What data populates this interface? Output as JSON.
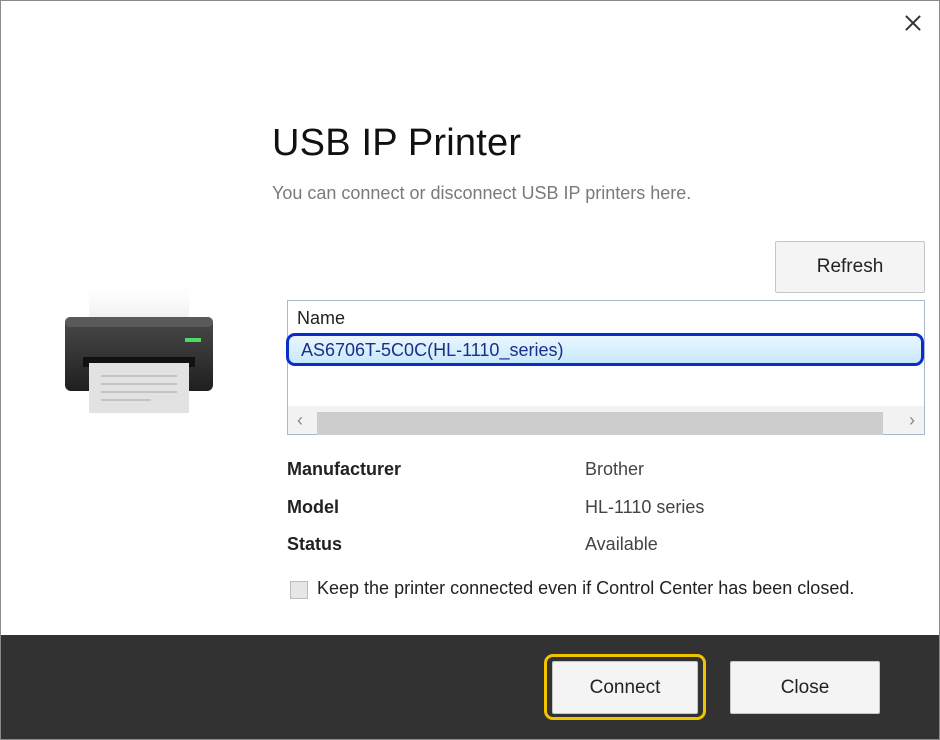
{
  "dialog": {
    "title": "USB IP Printer",
    "subtitle": "You can connect or disconnect USB IP printers here.",
    "close_icon": "close-icon"
  },
  "toolbar": {
    "refresh_label": "Refresh"
  },
  "printer_list": {
    "column_header": "Name",
    "selected_item": "AS6706T-5C0C(HL-1110_series)",
    "scroll_left": "‹",
    "scroll_right": "›"
  },
  "details": {
    "manufacturer_label": "Manufacturer",
    "manufacturer_value": "Brother",
    "model_label": "Model",
    "model_value": "HL-1110 series",
    "status_label": "Status",
    "status_value": "Available"
  },
  "options": {
    "keep_connected_label": "Keep the printer connected even if Control Center has been closed.",
    "keep_connected_checked": false
  },
  "footer": {
    "connect_label": "Connect",
    "close_label": "Close"
  },
  "colors": {
    "footer_bg": "#323232",
    "selection_border": "#0a2fc8",
    "focus_ring": "#f2c400"
  }
}
